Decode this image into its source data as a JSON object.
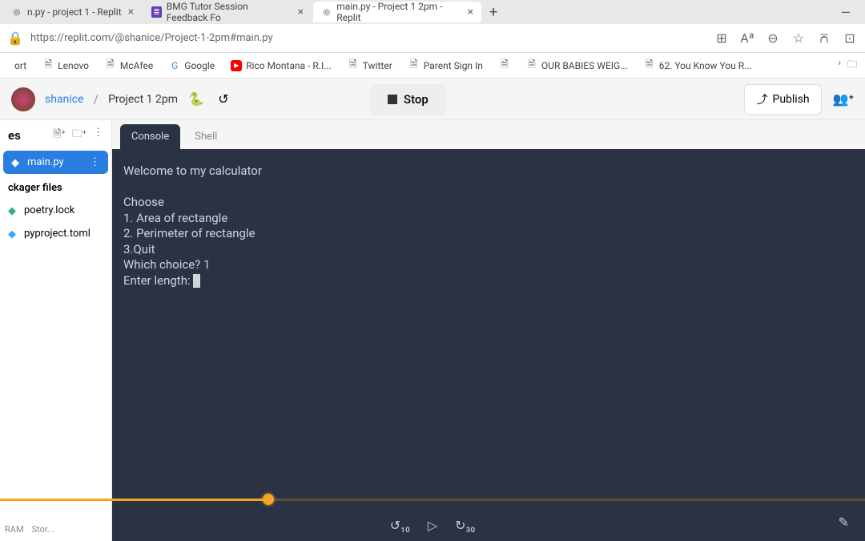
{
  "browser": {
    "tabs": [
      {
        "title": "n.py - project 1 - Replit",
        "active": false
      },
      {
        "title": "BMG Tutor Session Feedback Fo",
        "active": false
      },
      {
        "title": "main.py - Project 1 2pm - Replit",
        "active": true
      }
    ],
    "url": "https://replit.com/@shanice/Project-1-2pm#main.py",
    "bookmarks": [
      {
        "label": "ort"
      },
      {
        "label": "Lenovo"
      },
      {
        "label": "McAfee"
      },
      {
        "label": "Google"
      },
      {
        "label": "Rico Montana - R.I..."
      },
      {
        "label": "Twitter"
      },
      {
        "label": "Parent Sign In"
      },
      {
        "label": ""
      },
      {
        "label": "OUR BABIES WEIG..."
      },
      {
        "label": "62. You Know You R..."
      }
    ]
  },
  "replit": {
    "user": "shanice",
    "project": "Project 1 2pm",
    "stop_label": "Stop",
    "publish_label": "Publish"
  },
  "sidebar": {
    "title": "es",
    "files": [
      {
        "name": "main.py",
        "active": true
      }
    ],
    "section": "ckager files",
    "pkgfiles": [
      {
        "name": "poetry.lock"
      },
      {
        "name": "pyproject.toml"
      }
    ],
    "footer": [
      "RAM",
      "Stor..."
    ]
  },
  "editor": {
    "tabs": [
      {
        "label": "Console",
        "active": true
      },
      {
        "label": "Shell",
        "active": false
      }
    ],
    "lines": [
      "Welcome to my calculator",
      "",
      "Choose",
      "1. Area of rectangle",
      "2. Perimeter of rectangle",
      "3.Quit",
      "Which choice? 1",
      "Enter length: "
    ]
  }
}
